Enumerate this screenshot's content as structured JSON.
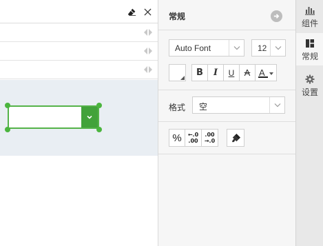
{
  "panel": {
    "title": "常规",
    "font": {
      "family_value": "Auto Font",
      "size_value": "12"
    },
    "format_buttons": {
      "bold": "B",
      "italic": "I",
      "underline": "U",
      "strike": "A",
      "font_color": "A"
    },
    "format_label": "格式",
    "format_value": "空",
    "number_buttons": {
      "percent": "%",
      "inc_top": "←.0",
      "inc_bottom": ".00",
      "dec_top": ".00",
      "dec_bottom": "→.0"
    }
  },
  "rail": {
    "tabs": [
      {
        "label": "组件",
        "icon": "bar-chart-icon"
      },
      {
        "label": "常规",
        "icon": "grid-icon",
        "active": true
      },
      {
        "label": "设置",
        "icon": "gear-icon"
      }
    ]
  },
  "colors": {
    "accent_green": "#42a23a",
    "selection_green": "#4bb53e",
    "canvas_bg": "#e9eef3",
    "panel_bg": "#f6f6f6"
  }
}
